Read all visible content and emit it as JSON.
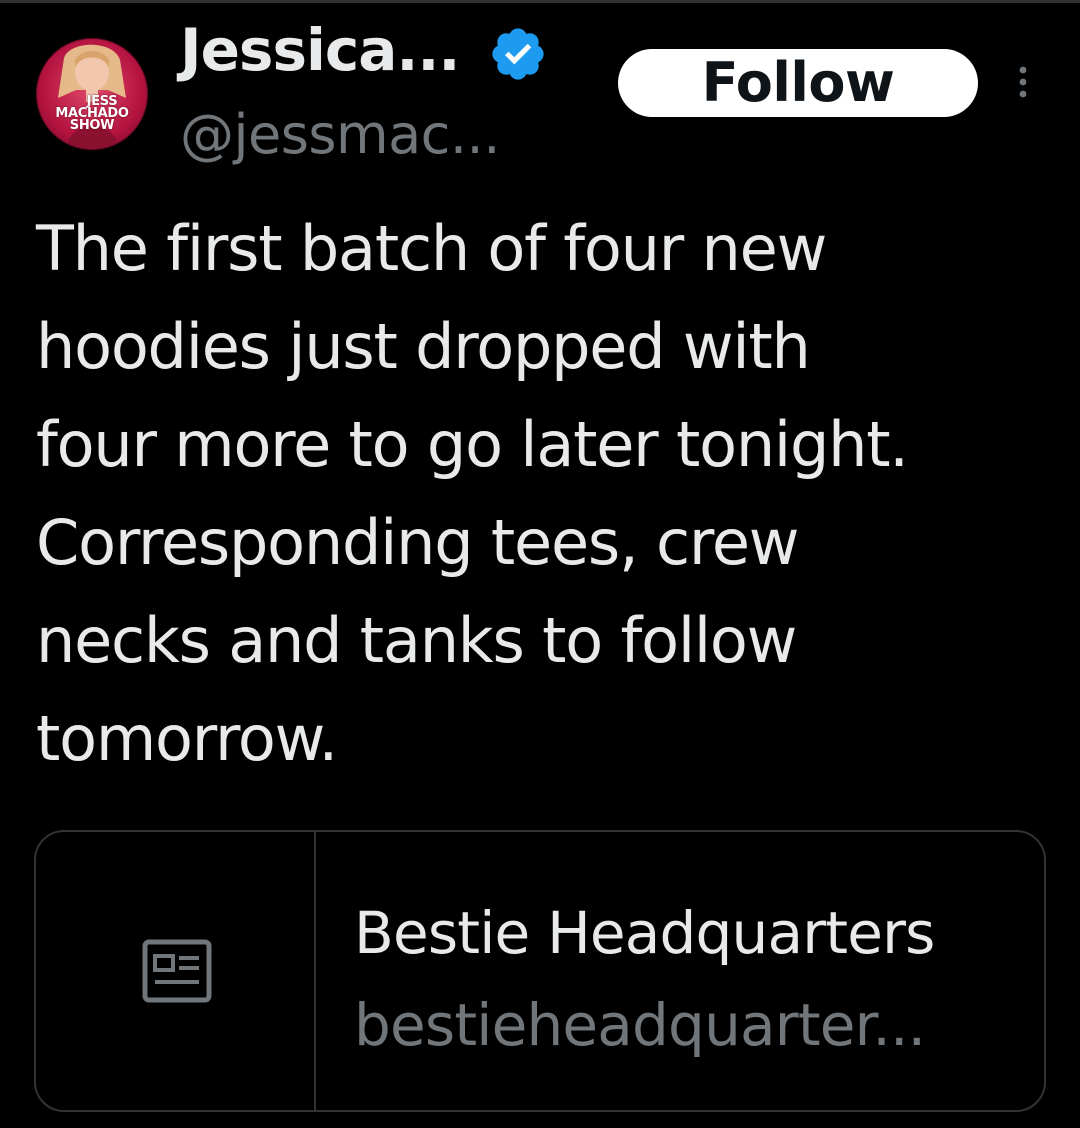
{
  "colors": {
    "background": "#000000",
    "text_primary": "#e7e9ea",
    "text_secondary": "#71767b",
    "border": "#2f3336",
    "verified_badge": "#1d9bf0",
    "follow_button_bg": "#ffffff",
    "follow_button_text": "#0f1419",
    "avatar_brand": "#b3123f"
  },
  "author": {
    "avatar_icon": "profile-photo",
    "avatar_logo_lines": [
      "JESS",
      "MACHADO",
      "SHOW"
    ],
    "display_name": "Jessica...",
    "verified_icon": "verified-badge-icon",
    "handle": "@jessmac..."
  },
  "actions": {
    "follow_label": "Follow",
    "more_icon": "more-vertical-icon"
  },
  "tweet": {
    "text_lines": [
      "The first batch of four new",
      "hoodies just dropped with",
      "four more to go later tonight.",
      "Corresponding tees, crew",
      "necks and tanks to follow",
      "tomorrow."
    ]
  },
  "link_card": {
    "icon": "news-article-icon",
    "title": "Bestie Headquarters",
    "domain": "bestieheadquarter..."
  }
}
